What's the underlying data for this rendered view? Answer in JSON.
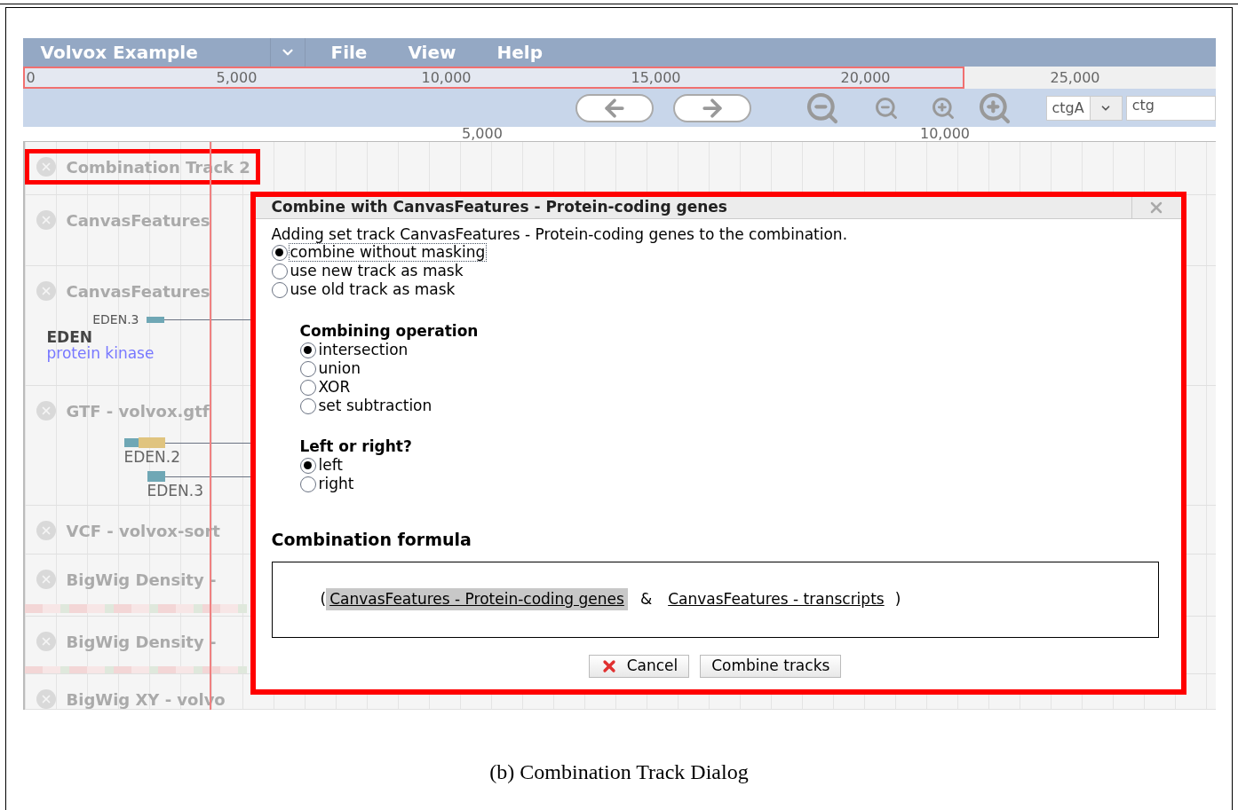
{
  "menu_bar": {
    "title": "Volvox Example",
    "menus": [
      "File",
      "View",
      "Help"
    ]
  },
  "overview_ruler": {
    "start": "0",
    "ticks": [
      "5,000",
      "10,000",
      "15,000",
      "20,000",
      "25,000"
    ]
  },
  "navigation": {
    "reference": "ctgA",
    "next_field": "ctg"
  },
  "detail_ruler": {
    "ticks": [
      "5,000",
      "10,000"
    ]
  },
  "tracks": [
    {
      "kind": "plain",
      "label": "Combination Track 2",
      "highlighted": true
    },
    {
      "kind": "plain",
      "label": "CanvasFeatures",
      "highlighted": false
    },
    {
      "kind": "gene",
      "label": "CanvasFeatures",
      "highlighted": false,
      "features": [
        "EDEN.3"
      ],
      "gene": {
        "name": "EDEN",
        "description": "protein kinase"
      }
    },
    {
      "kind": "transcripts",
      "label": "GTF - volvox.gtf",
      "highlighted": false,
      "features": [
        "EDEN.2",
        "EDEN.3"
      ]
    },
    {
      "kind": "variants",
      "label": "VCF - volvox-sort",
      "highlighted": false
    },
    {
      "kind": "density",
      "label": "BigWig Density -",
      "highlighted": false
    },
    {
      "kind": "density",
      "label": "BigWig Density -",
      "highlighted": false
    },
    {
      "kind": "xy",
      "label": "BigWig XY - volvo",
      "highlighted": false
    }
  ],
  "dialog": {
    "title": "Combine with CanvasFeatures - Protein-coding genes",
    "highlighted": true,
    "message": "Adding set track CanvasFeatures - Protein-coding genes to the combination.",
    "mask_options": [
      {
        "label": "combine without masking",
        "selected": true,
        "focused": true
      },
      {
        "label": "use new track as mask",
        "selected": false,
        "focused": false
      },
      {
        "label": "use old track as mask",
        "selected": false,
        "focused": false
      }
    ],
    "operation": {
      "heading": "Combining operation",
      "options": [
        {
          "label": "intersection",
          "selected": true
        },
        {
          "label": "union",
          "selected": false
        },
        {
          "label": "XOR",
          "selected": false
        },
        {
          "label": "set subtraction",
          "selected": false
        }
      ]
    },
    "side": {
      "heading": "Left or right?",
      "options": [
        {
          "label": "left",
          "selected": true
        },
        {
          "label": "right",
          "selected": false
        }
      ]
    },
    "formula": {
      "heading": "Combination formula",
      "open": "(",
      "left": {
        "text": "CanvasFeatures - Protein-coding genes",
        "selected": true
      },
      "operator": "&",
      "right": {
        "text": "CanvasFeatures - transcripts",
        "selected": false
      },
      "close": ")"
    },
    "buttons": [
      {
        "kind": "cancel",
        "label": "Cancel"
      },
      {
        "kind": "plain",
        "label": "Combine tracks"
      }
    ]
  },
  "caption": "(b) Combination Track Dialog"
}
